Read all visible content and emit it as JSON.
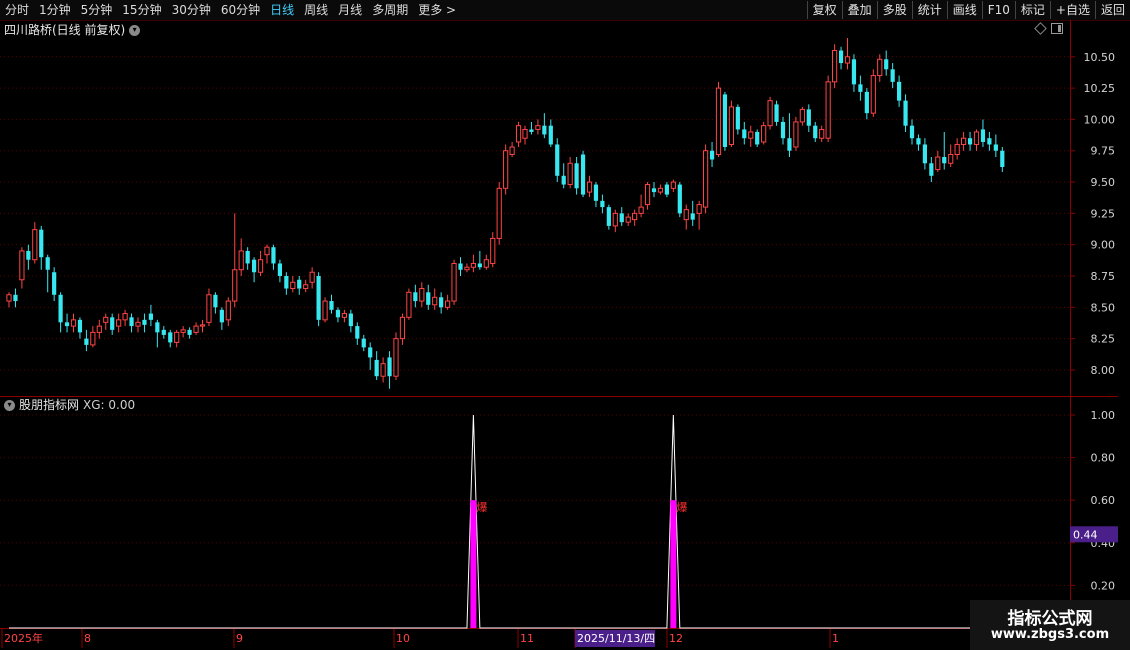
{
  "toolbar": {
    "tabs": [
      "分时",
      "1分钟",
      "5分钟",
      "15分钟",
      "30分钟",
      "60分钟",
      "日线",
      "周线",
      "月线",
      "多周期",
      "更多 >"
    ],
    "active_tab": "日线",
    "right_buttons": [
      "复权",
      "叠加",
      "多股",
      "统计",
      "画线",
      "F10",
      "标记",
      "+自选",
      "返回"
    ]
  },
  "main_chart": {
    "title": "四川路桥(日线 前复权)",
    "y_ticks": [
      "10.50",
      "10.25",
      "10.00",
      "9.75",
      "9.50",
      "9.25",
      "9.00",
      "8.75",
      "8.50",
      "8.25",
      "8.00"
    ]
  },
  "indicator": {
    "name": "股朋指标网",
    "value_label": "XG: 0.00",
    "y_ticks": [
      "1.00",
      "0.80",
      "0.60",
      "0.40",
      "0.20"
    ],
    "cursor_value": "0.44",
    "signal_text": "爆"
  },
  "x_axis": {
    "labels": [
      "2025年",
      "8",
      "9",
      "10",
      "11",
      "2025/11/13/四",
      "12",
      "1"
    ]
  },
  "watermark": {
    "line1": "指标公式网",
    "line2": "www.zbgs3.com"
  },
  "colors": {
    "up": "#ff4545",
    "down": "#38e8f0",
    "grid": "#5a0000",
    "signal": "#ff00ff",
    "cursor_bg": "#4a1f8a"
  },
  "chart_data": [
    {
      "type": "candlestick",
      "title": "四川路桥(日线 前复权)",
      "ylim": [
        7.8,
        10.65
      ],
      "up_color": "#ff4545",
      "down_color": "#38e8f0",
      "candles": [
        [
          8.55,
          8.6,
          8.5,
          8.62
        ],
        [
          8.6,
          8.55,
          8.5,
          8.65
        ],
        [
          8.72,
          8.95,
          8.65,
          8.98
        ],
        [
          8.95,
          8.88,
          8.8,
          9.0
        ],
        [
          8.88,
          9.12,
          8.85,
          9.18
        ],
        [
          9.12,
          8.9,
          8.8,
          9.15
        ],
        [
          8.9,
          8.8,
          8.62,
          8.92
        ],
        [
          8.78,
          8.6,
          8.55,
          8.82
        ],
        [
          8.6,
          8.38,
          8.3,
          8.62
        ],
        [
          8.38,
          8.35,
          8.3,
          8.45
        ],
        [
          8.35,
          8.4,
          8.3,
          8.45
        ],
        [
          8.4,
          8.3,
          8.25,
          8.42
        ],
        [
          8.25,
          8.2,
          8.15,
          8.32
        ],
        [
          8.2,
          8.3,
          8.18,
          8.35
        ],
        [
          8.3,
          8.35,
          8.25,
          8.4
        ],
        [
          8.38,
          8.42,
          8.32,
          8.45
        ],
        [
          8.42,
          8.32,
          8.28,
          8.45
        ],
        [
          8.35,
          8.4,
          8.3,
          8.45
        ],
        [
          8.4,
          8.45,
          8.35,
          8.48
        ],
        [
          8.42,
          8.35,
          8.3,
          8.45
        ],
        [
          8.35,
          8.38,
          8.3,
          8.42
        ],
        [
          8.4,
          8.36,
          8.3,
          8.45
        ],
        [
          8.45,
          8.4,
          8.35,
          8.52
        ],
        [
          8.38,
          8.3,
          8.18,
          8.4
        ],
        [
          8.32,
          8.28,
          8.25,
          8.35
        ],
        [
          8.3,
          8.22,
          8.18,
          8.32
        ],
        [
          8.22,
          8.3,
          8.18,
          8.32
        ],
        [
          8.3,
          8.32,
          8.26,
          8.35
        ],
        [
          8.32,
          8.28,
          8.25,
          8.34
        ],
        [
          8.3,
          8.35,
          8.28,
          8.38
        ],
        [
          8.35,
          8.36,
          8.3,
          8.4
        ],
        [
          8.38,
          8.6,
          8.35,
          8.65
        ],
        [
          8.6,
          8.5,
          8.45,
          8.62
        ],
        [
          8.48,
          8.38,
          8.32,
          8.5
        ],
        [
          8.4,
          8.55,
          8.35,
          8.58
        ],
        [
          8.55,
          8.8,
          8.5,
          9.25
        ],
        [
          8.8,
          8.95,
          8.75,
          9.05
        ],
        [
          8.95,
          8.85,
          8.8,
          8.98
        ],
        [
          8.88,
          8.78,
          8.7,
          8.9
        ],
        [
          8.78,
          8.88,
          8.75,
          8.95
        ],
        [
          8.92,
          8.98,
          8.85,
          9.0
        ],
        [
          8.98,
          8.85,
          8.8,
          9.0
        ],
        [
          8.85,
          8.75,
          8.7,
          8.88
        ],
        [
          8.75,
          8.65,
          8.6,
          8.78
        ],
        [
          8.65,
          8.7,
          8.62,
          8.75
        ],
        [
          8.72,
          8.65,
          8.6,
          8.75
        ],
        [
          8.65,
          8.68,
          8.62,
          8.72
        ],
        [
          8.7,
          8.78,
          8.65,
          8.82
        ],
        [
          8.75,
          8.4,
          8.35,
          8.78
        ],
        [
          8.4,
          8.55,
          8.38,
          8.58
        ],
        [
          8.55,
          8.48,
          8.45,
          8.6
        ],
        [
          8.48,
          8.42,
          8.38,
          8.5
        ],
        [
          8.42,
          8.45,
          8.38,
          8.48
        ],
        [
          8.45,
          8.35,
          8.3,
          8.48
        ],
        [
          8.35,
          8.25,
          8.2,
          8.38
        ],
        [
          8.25,
          8.18,
          8.15,
          8.28
        ],
        [
          8.18,
          8.1,
          8.0,
          8.22
        ],
        [
          8.08,
          7.95,
          7.92,
          8.15
        ],
        [
          7.95,
          8.05,
          7.9,
          8.1
        ],
        [
          8.1,
          7.95,
          7.85,
          8.15
        ],
        [
          7.95,
          8.25,
          7.92,
          8.3
        ],
        [
          8.25,
          8.42,
          8.2,
          8.45
        ],
        [
          8.42,
          8.62,
          8.4,
          8.65
        ],
        [
          8.62,
          8.55,
          8.5,
          8.68
        ],
        [
          8.55,
          8.65,
          8.5,
          8.7
        ],
        [
          8.62,
          8.52,
          8.48,
          8.68
        ],
        [
          8.52,
          8.58,
          8.48,
          8.65
        ],
        [
          8.58,
          8.5,
          8.45,
          8.62
        ],
        [
          8.5,
          8.55,
          8.48,
          8.6
        ],
        [
          8.55,
          8.85,
          8.52,
          8.88
        ],
        [
          8.85,
          8.8,
          8.75,
          8.9
        ],
        [
          8.8,
          8.82,
          8.78,
          8.85
        ],
        [
          8.82,
          8.85,
          8.78,
          8.92
        ],
        [
          8.85,
          8.82,
          8.8,
          8.95
        ],
        [
          8.82,
          8.88,
          8.8,
          8.92
        ],
        [
          8.85,
          9.05,
          8.82,
          9.1
        ],
        [
          9.05,
          9.45,
          9.0,
          9.5
        ],
        [
          9.45,
          9.75,
          9.4,
          9.8
        ],
        [
          9.72,
          9.78,
          9.7,
          9.82
        ],
        [
          9.82,
          9.95,
          9.78,
          9.98
        ],
        [
          9.85,
          9.92,
          9.8,
          9.95
        ],
        [
          9.92,
          9.9,
          9.88,
          9.98
        ],
        [
          9.92,
          9.95,
          9.88,
          10.0
        ],
        [
          9.95,
          9.88,
          9.85,
          10.05
        ],
        [
          9.95,
          9.8,
          9.78,
          10.0
        ],
        [
          9.8,
          9.55,
          9.5,
          9.85
        ],
        [
          9.55,
          9.48,
          9.45,
          9.65
        ],
        [
          9.48,
          9.65,
          9.45,
          9.7
        ],
        [
          9.65,
          9.45,
          9.4,
          9.7
        ],
        [
          9.72,
          9.4,
          9.38,
          9.75
        ],
        [
          9.42,
          9.5,
          9.38,
          9.55
        ],
        [
          9.48,
          9.35,
          9.3,
          9.5
        ],
        [
          9.35,
          9.3,
          9.25,
          9.4
        ],
        [
          9.3,
          9.15,
          9.12,
          9.32
        ],
        [
          9.15,
          9.25,
          9.1,
          9.28
        ],
        [
          9.25,
          9.18,
          9.15,
          9.3
        ],
        [
          9.18,
          9.22,
          9.15,
          9.25
        ],
        [
          9.2,
          9.25,
          9.15,
          9.28
        ],
        [
          9.25,
          9.3,
          9.22,
          9.4
        ],
        [
          9.32,
          9.48,
          9.28,
          9.5
        ],
        [
          9.45,
          9.42,
          9.38,
          9.5
        ],
        [
          9.42,
          9.45,
          9.4,
          9.48
        ],
        [
          9.48,
          9.4,
          9.38,
          9.5
        ],
        [
          9.45,
          9.5,
          9.42,
          9.52
        ],
        [
          9.48,
          9.25,
          9.22,
          9.5
        ],
        [
          9.2,
          9.28,
          9.12,
          9.32
        ],
        [
          9.25,
          9.2,
          9.15,
          9.35
        ],
        [
          9.25,
          9.32,
          9.12,
          9.35
        ],
        [
          9.3,
          9.75,
          9.25,
          9.8
        ],
        [
          9.75,
          9.68,
          9.62,
          9.82
        ],
        [
          9.72,
          10.25,
          9.7,
          10.3
        ],
        [
          10.2,
          9.78,
          9.75,
          10.22
        ],
        [
          9.8,
          10.1,
          9.78,
          10.15
        ],
        [
          10.1,
          9.92,
          9.88,
          10.12
        ],
        [
          9.92,
          9.85,
          9.8,
          9.98
        ],
        [
          9.85,
          9.9,
          9.78,
          9.95
        ],
        [
          9.9,
          9.8,
          9.78,
          9.92
        ],
        [
          9.82,
          9.95,
          9.8,
          9.98
        ],
        [
          9.95,
          10.15,
          9.92,
          10.18
        ],
        [
          10.12,
          9.98,
          9.95,
          10.15
        ],
        [
          9.98,
          9.85,
          9.8,
          10.02
        ],
        [
          9.85,
          9.75,
          9.7,
          10.05
        ],
        [
          9.78,
          9.98,
          9.75,
          10.02
        ],
        [
          9.98,
          10.08,
          9.95,
          10.1
        ],
        [
          10.08,
          9.95,
          9.9,
          10.12
        ],
        [
          9.95,
          9.85,
          9.82,
          9.98
        ],
        [
          9.85,
          9.92,
          9.82,
          9.95
        ],
        [
          9.85,
          10.3,
          9.82,
          10.35
        ],
        [
          10.3,
          10.55,
          10.25,
          10.6
        ],
        [
          10.55,
          10.45,
          10.4,
          10.58
        ],
        [
          10.45,
          10.5,
          10.4,
          10.65
        ],
        [
          10.48,
          10.28,
          10.22,
          10.52
        ],
        [
          10.28,
          10.22,
          10.15,
          10.35
        ],
        [
          10.22,
          10.05,
          10.0,
          10.25
        ],
        [
          10.05,
          10.35,
          10.02,
          10.4
        ],
        [
          10.35,
          10.48,
          10.3,
          10.52
        ],
        [
          10.48,
          10.4,
          10.35,
          10.55
        ],
        [
          10.4,
          10.3,
          10.25,
          10.45
        ],
        [
          10.3,
          10.15,
          10.1,
          10.35
        ],
        [
          10.15,
          9.95,
          9.9,
          10.2
        ],
        [
          9.95,
          9.85,
          9.8,
          10.0
        ],
        [
          9.85,
          9.8,
          9.75,
          9.88
        ],
        [
          9.8,
          9.65,
          9.6,
          9.85
        ],
        [
          9.65,
          9.55,
          9.5,
          9.7
        ],
        [
          9.6,
          9.7,
          9.58,
          9.75
        ],
        [
          9.7,
          9.65,
          9.6,
          9.9
        ],
        [
          9.65,
          9.72,
          9.62,
          9.8
        ],
        [
          9.72,
          9.8,
          9.68,
          9.85
        ],
        [
          9.8,
          9.85,
          9.75,
          9.9
        ],
        [
          9.85,
          9.8,
          9.75,
          9.9
        ],
        [
          9.8,
          9.9,
          9.75,
          9.92
        ],
        [
          9.92,
          9.82,
          9.78,
          10.0
        ],
        [
          9.85,
          9.8,
          9.75,
          9.9
        ],
        [
          9.8,
          9.75,
          9.7,
          9.88
        ],
        [
          9.75,
          9.62,
          9.58,
          9.78
        ]
      ]
    },
    {
      "type": "line",
      "series": [
        {
          "name": "XG",
          "signal_indices": [
            72,
            103
          ],
          "values": [
            0,
            0,
            0,
            0,
            0,
            0,
            0,
            0,
            0,
            0,
            0,
            0,
            0,
            0,
            0,
            0,
            0,
            0,
            0,
            0,
            0,
            0,
            0,
            0,
            0,
            0,
            0,
            0,
            0,
            0,
            0,
            0,
            0,
            0,
            0,
            0,
            0,
            0,
            0,
            0,
            0,
            0,
            0,
            0,
            0,
            0,
            0,
            0,
            0,
            0,
            0,
            0,
            0,
            0,
            0,
            0,
            0,
            0,
            0,
            0,
            0,
            0,
            0,
            0,
            0,
            0,
            0,
            0,
            0,
            0,
            0,
            0,
            1,
            0,
            0,
            0,
            0,
            0,
            0,
            0,
            0,
            0,
            0,
            0,
            0,
            0,
            0,
            0,
            0,
            0,
            0,
            0,
            0,
            0,
            0,
            0,
            0,
            0,
            0,
            0,
            0,
            0,
            0,
            1,
            0,
            0,
            0,
            0,
            0,
            0,
            0,
            0,
            0,
            0,
            0,
            0,
            0,
            0,
            0,
            0,
            0,
            0,
            0,
            0,
            0,
            0,
            0,
            0,
            0,
            0,
            0,
            0,
            0,
            0,
            0,
            0,
            0,
            0,
            0,
            0,
            0,
            0,
            0,
            0,
            0,
            0,
            0,
            0,
            0,
            0,
            0,
            0,
            0,
            0,
            0,
            0
          ]
        }
      ],
      "ylim": [
        0,
        1.08
      ]
    }
  ]
}
